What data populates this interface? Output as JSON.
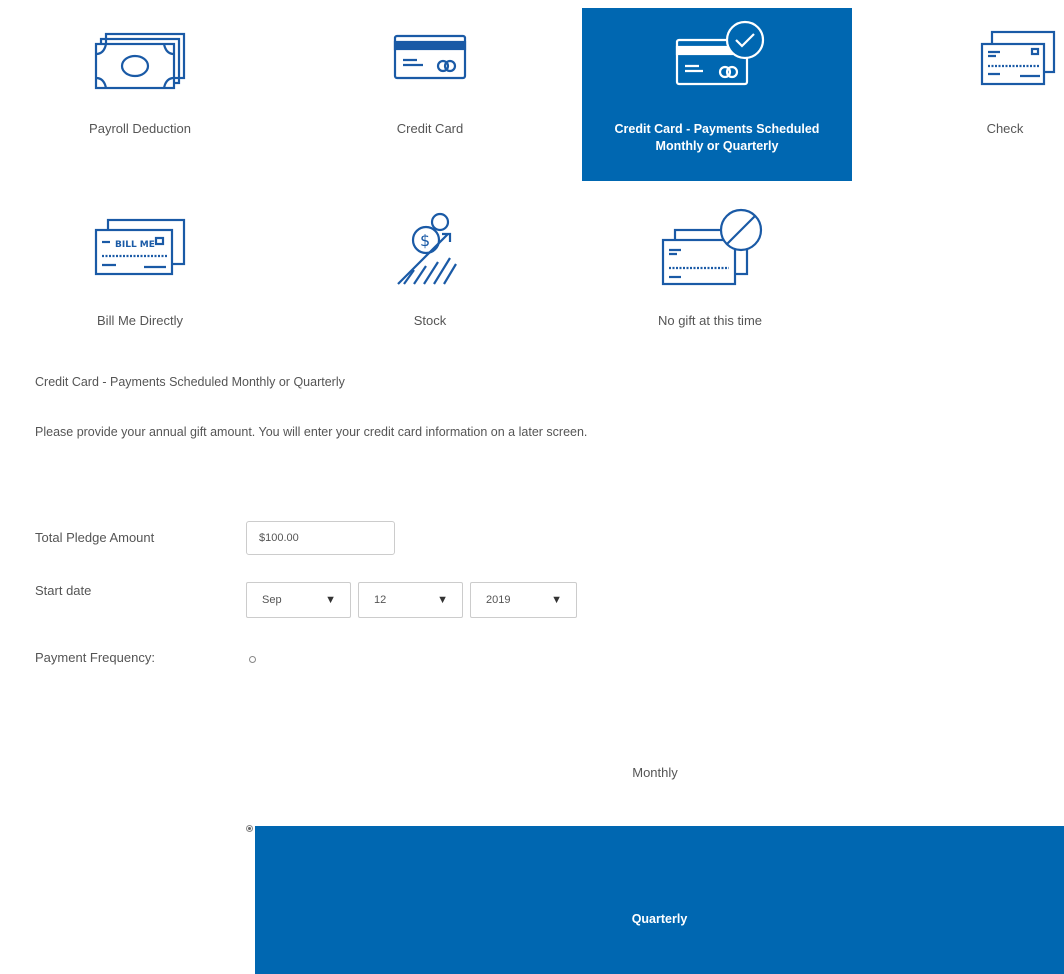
{
  "payment_methods": [
    {
      "label": "Payroll Deduction",
      "icon": "cash-icon",
      "selected": false
    },
    {
      "label": "Credit Card",
      "icon": "credit-card-icon",
      "selected": false
    },
    {
      "label": "Credit Card - Payments Scheduled Monthly or Quarterly",
      "icon": "credit-card-check-icon",
      "selected": true
    },
    {
      "label": "Check",
      "icon": "check-icon",
      "selected": false
    },
    {
      "label": "Bill Me Directly",
      "icon": "bill-me-icon",
      "icon_text": "BILL ME",
      "selected": false
    },
    {
      "label": "Stock",
      "icon": "stock-icon",
      "selected": false
    },
    {
      "label": "No gift at this time",
      "icon": "no-gift-icon",
      "selected": false
    }
  ],
  "selected_heading": "Credit Card - Payments Scheduled Monthly or Quarterly",
  "instructions": "Please provide your annual gift amount. You will enter your credit card information on a later screen.",
  "form": {
    "pledge_label": "Total Pledge Amount",
    "pledge_value": "$100.00",
    "start_date_label": "Start date",
    "start_month": "Sep",
    "start_day": "12",
    "start_year": "2019",
    "frequency_label": "Payment Frequency:",
    "frequency_options": [
      {
        "label": "Monthly",
        "selected": false
      },
      {
        "label": "Quarterly",
        "selected": true
      }
    ]
  },
  "colors": {
    "accent": "#0067b1",
    "icon_stroke": "#1a5aa6"
  }
}
